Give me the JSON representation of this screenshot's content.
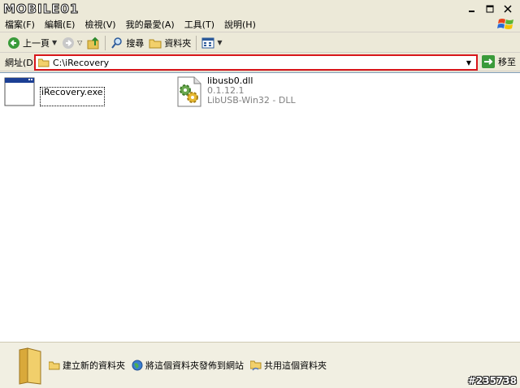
{
  "logo": {
    "text": "MOBILE01"
  },
  "menubar": {
    "items": [
      {
        "label": "檔案(F)"
      },
      {
        "label": "編輯(E)"
      },
      {
        "label": "檢視(V)"
      },
      {
        "label": "我的最愛(A)"
      },
      {
        "label": "工具(T)"
      },
      {
        "label": "說明(H)"
      }
    ]
  },
  "toolbar": {
    "back_label": "上一頁",
    "search_label": "搜尋",
    "folders_label": "資料夾"
  },
  "addressbar": {
    "label": "網址(D)",
    "value": "C:\\iRecovery",
    "go_label": "移至"
  },
  "files": [
    {
      "name": "iRecovery.exe",
      "icon": "exe-window-icon"
    },
    {
      "name": "libusb0.dll",
      "version": "0.1.12.1",
      "description": "LibUSB-Win32 - DLL",
      "icon": "dll-gear-icon"
    }
  ],
  "tasks": {
    "new_folder": "建立新的資料夾",
    "publish_web": "將這個資料夾發佈到網站",
    "share_folder": "共用這個資料夾"
  },
  "watermark": "#235738",
  "colors": {
    "highlight_border": "#d8161b",
    "content_bg": "#ffffff",
    "chrome_bg": "#ece9d8"
  }
}
